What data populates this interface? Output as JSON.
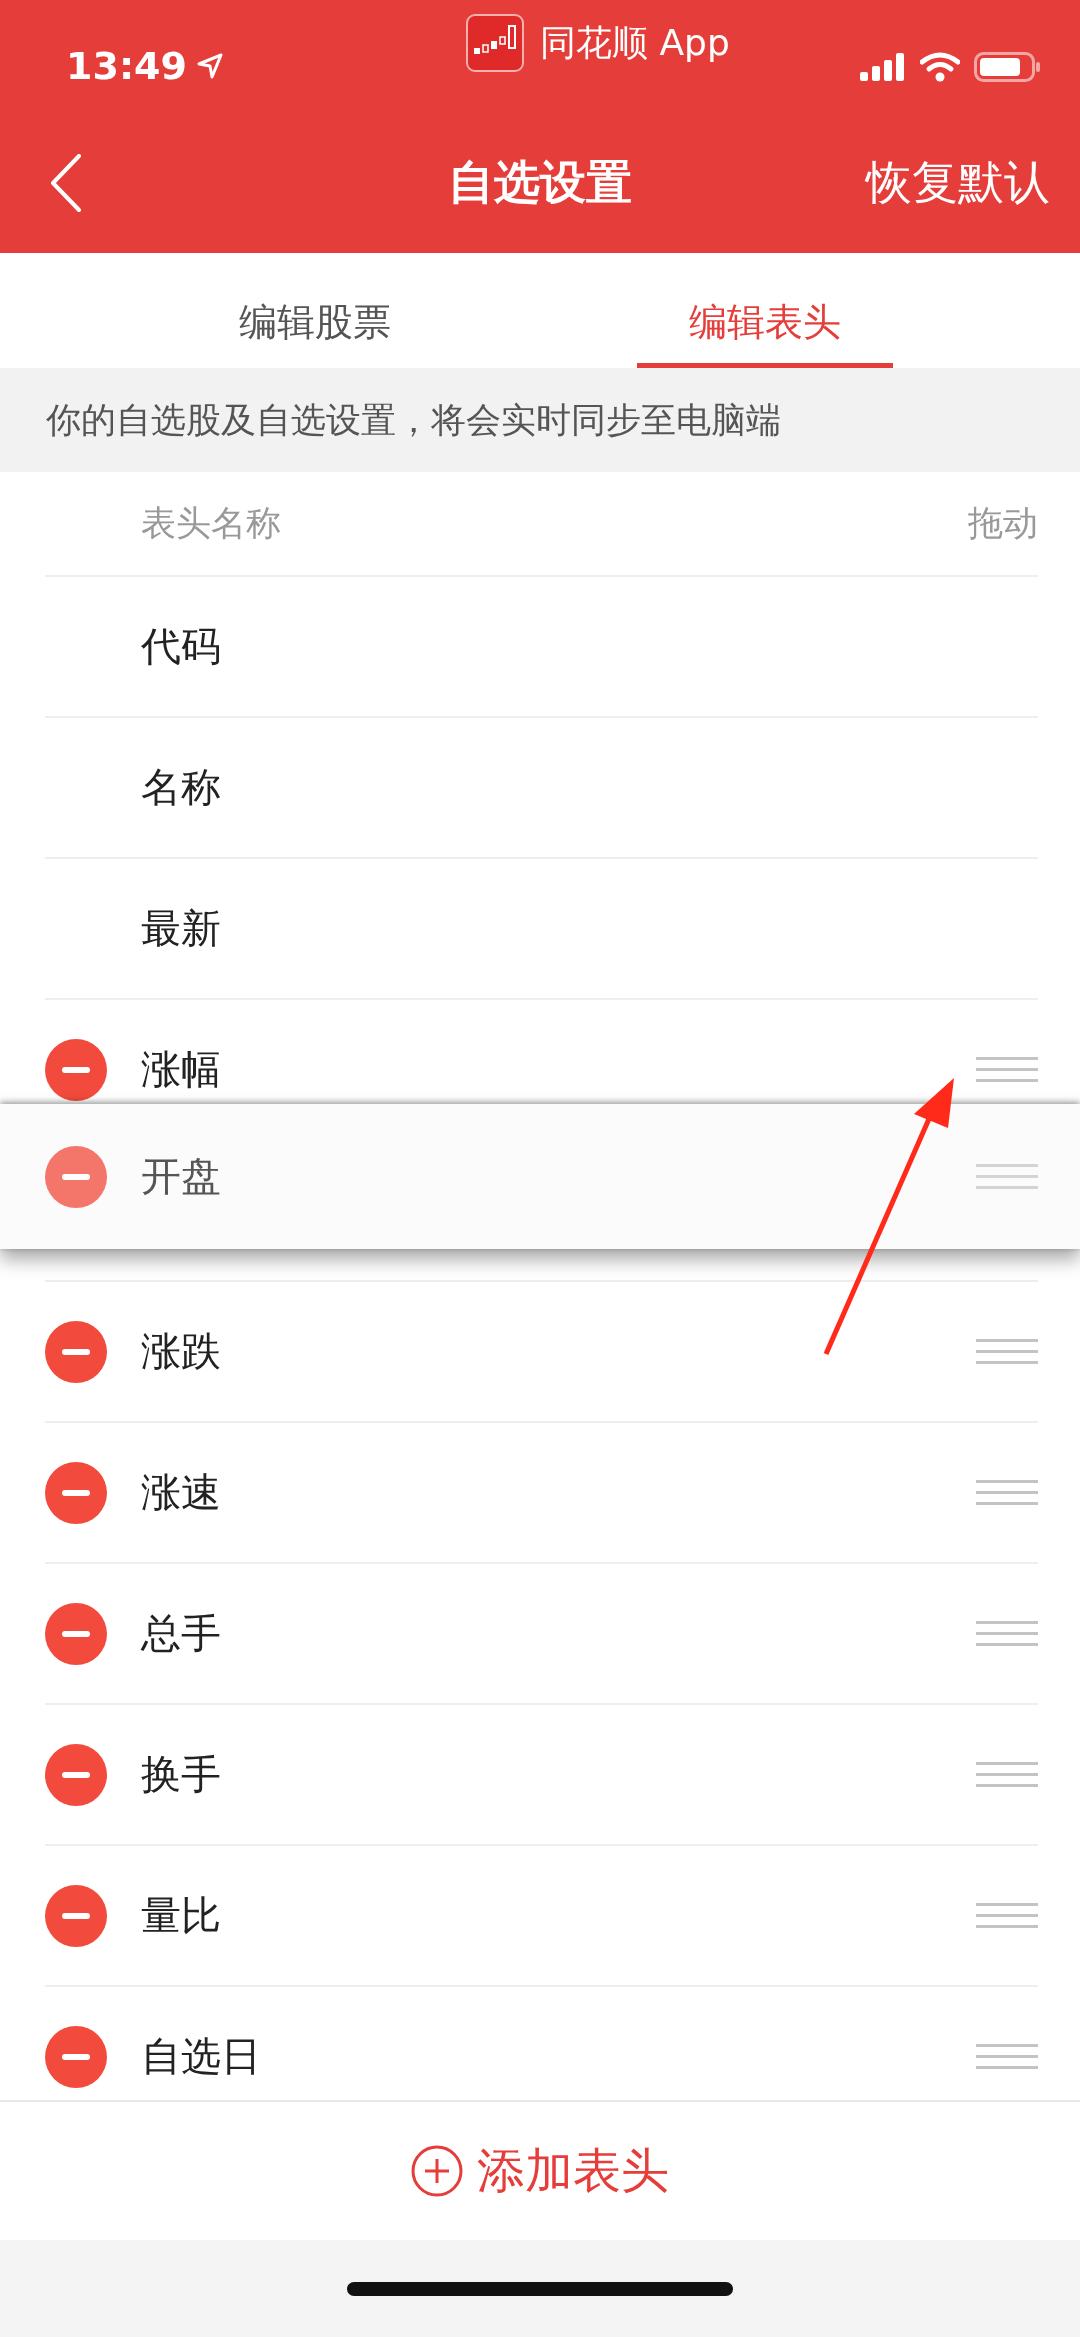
{
  "status_bar": {
    "time": "13:49",
    "app": "同花顺 App"
  },
  "nav": {
    "title": "自选设置",
    "action": "恢复默认"
  },
  "tabs": [
    {
      "label": "编辑股票",
      "selected": false
    },
    {
      "label": "编辑表头",
      "selected": true
    }
  ],
  "notice": "你的自选股及自选设置，将会实时同步至电脑端",
  "list_header": {
    "name": "表头名称",
    "drag": "拖动"
  },
  "rows": [
    {
      "label": "代码",
      "kind": "fixed"
    },
    {
      "label": "名称",
      "kind": "fixed"
    },
    {
      "label": "最新",
      "kind": "fixed"
    },
    {
      "label": "涨幅",
      "kind": "removable"
    },
    {
      "kind": "placeholder"
    },
    {
      "label": "涨跌",
      "kind": "removable"
    },
    {
      "label": "涨速",
      "kind": "removable"
    },
    {
      "label": "总手",
      "kind": "removable"
    },
    {
      "label": "换手",
      "kind": "removable"
    },
    {
      "label": "量比",
      "kind": "removable"
    },
    {
      "label": "自选日",
      "kind": "removable"
    }
  ],
  "dragging_row": {
    "label": "开盘"
  },
  "add_button": "添加表头"
}
